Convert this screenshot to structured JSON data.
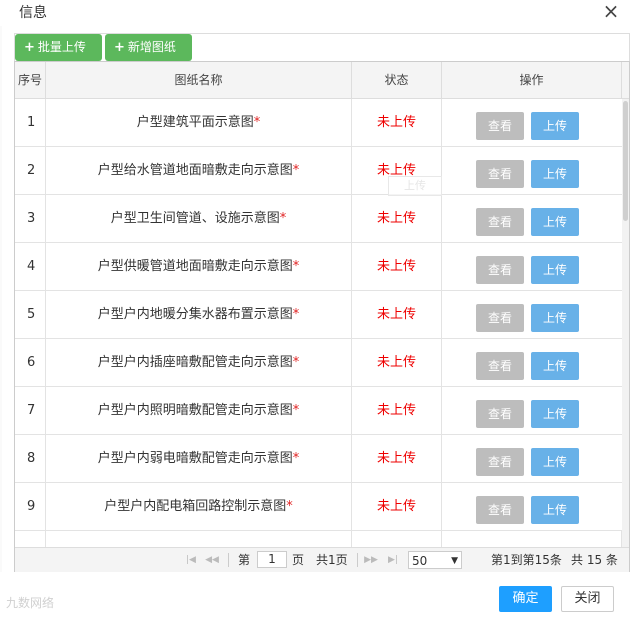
{
  "dialog": {
    "title": "信息",
    "close_glyph": "×"
  },
  "toolbar": {
    "batch_upload": "批量上传",
    "add_drawing": "新增图纸",
    "plus_glyph": "+"
  },
  "table": {
    "headers": [
      "序号",
      "图纸名称",
      "状态",
      "操作"
    ],
    "required_mark": "*",
    "rows": [
      {
        "no": "1",
        "name": "户型建筑平面示意图",
        "status": "未上传",
        "view": "查看",
        "upload": "上传"
      },
      {
        "no": "2",
        "name": "户型给水管道地面暗敷走向示意图",
        "status": "未上传",
        "view": "查看",
        "upload": "上传"
      },
      {
        "no": "3",
        "name": "户型卫生间管道、设施示意图",
        "status": "未上传",
        "view": "查看",
        "upload": "上传"
      },
      {
        "no": "4",
        "name": "户型供暖管道地面暗敷走向示意图",
        "status": "未上传",
        "view": "查看",
        "upload": "上传"
      },
      {
        "no": "5",
        "name": "户型户内地暖分集水器布置示意图",
        "status": "未上传",
        "view": "查看",
        "upload": "上传"
      },
      {
        "no": "6",
        "name": "户型户内插座暗敷配管走向示意图",
        "status": "未上传",
        "view": "查看",
        "upload": "上传"
      },
      {
        "no": "7",
        "name": "户型户内照明暗敷配管走向示意图",
        "status": "未上传",
        "view": "查看",
        "upload": "上传"
      },
      {
        "no": "8",
        "name": "户型户内弱电暗敷配管走向示意图",
        "status": "未上传",
        "view": "查看",
        "upload": "上传"
      },
      {
        "no": "9",
        "name": "户型户内配电箱回路控制示意图",
        "status": "未上传",
        "view": "查看",
        "upload": "上传"
      }
    ],
    "ghost_tooltip": "上传"
  },
  "pager": {
    "page_prefix": "第",
    "page_value": "1",
    "page_suffix": "页",
    "total_pages": "共1页",
    "page_size": "50",
    "range_text": "第1到第15条",
    "total_text": "共 15 条",
    "first_icon": "first-page-icon",
    "prev_icon": "prev-page-icon",
    "next_icon": "next-page-icon",
    "last_icon": "last-page-icon"
  },
  "footer": {
    "confirm": "确定",
    "close": "关闭",
    "watermark": "九数网络"
  }
}
